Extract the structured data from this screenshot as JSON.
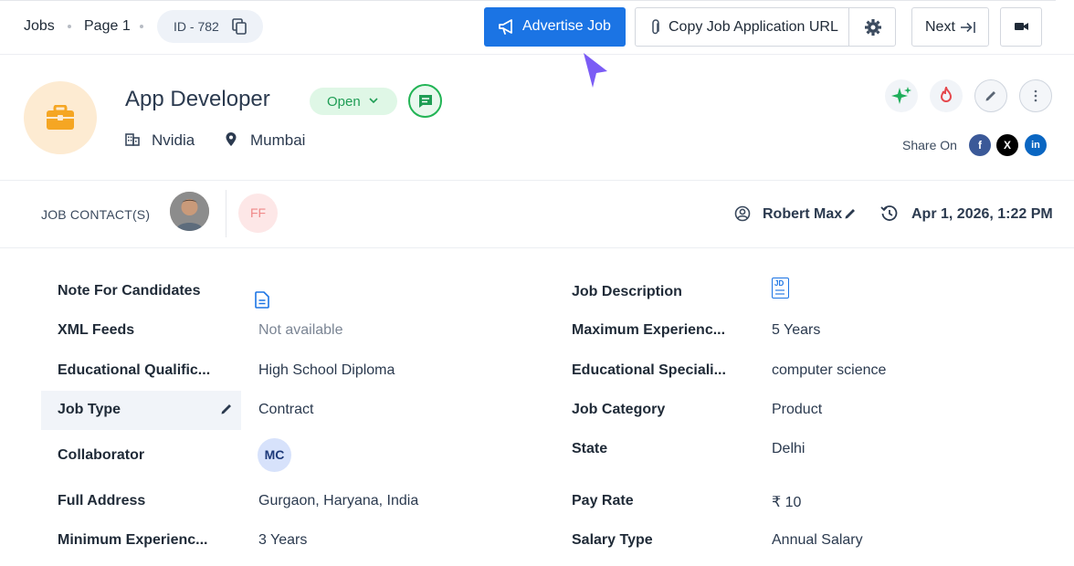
{
  "topbar": {
    "breadcrumb_jobs": "Jobs",
    "breadcrumb_page": "Page 1",
    "job_id": "ID - 782",
    "advertise_label": "Advertise Job",
    "copy_url_label": "Copy Job Application URL",
    "next_label": "Next"
  },
  "job": {
    "title": "App Developer",
    "status": "Open",
    "company": "Nvidia",
    "location": "Mumbai",
    "share_label": "Share On",
    "share": {
      "facebook": "f",
      "x": "X",
      "linkedin": "in"
    }
  },
  "contacts": {
    "label": "JOB CONTACT(S)",
    "initials": "FF",
    "owner": "Robert Max",
    "timestamp": "Apr 1, 2026, 1:22 PM"
  },
  "details_left": [
    {
      "label": "Note For Candidates",
      "value": ""
    },
    {
      "label": "XML Feeds",
      "value": "Not available"
    },
    {
      "label": "Educational Qualific...",
      "value": "High School Diploma"
    },
    {
      "label": "Job Type",
      "value": "Contract"
    },
    {
      "label": "Collaborator",
      "value": "MC"
    },
    {
      "label": "Full Address",
      "value": "Gurgaon, Haryana, India"
    },
    {
      "label": "Minimum Experienc...",
      "value": "3 Years"
    }
  ],
  "details_right": [
    {
      "label": "Job Description",
      "value": "JD"
    },
    {
      "label": "Maximum Experienc...",
      "value": "5 Years"
    },
    {
      "label": "Educational Speciali...",
      "value": "computer science"
    },
    {
      "label": "Job Category",
      "value": "Product"
    },
    {
      "label": "State",
      "value": "Delhi"
    },
    {
      "label": "Pay Rate",
      "value": "₹ 10"
    },
    {
      "label": "Salary Type",
      "value": "Annual Salary"
    }
  ],
  "colors": {
    "primary": "#1b74e4",
    "status_green": "#1f9d55",
    "briefcase_orange": "#f5a623",
    "cursor_purple": "#7b5cf5"
  }
}
